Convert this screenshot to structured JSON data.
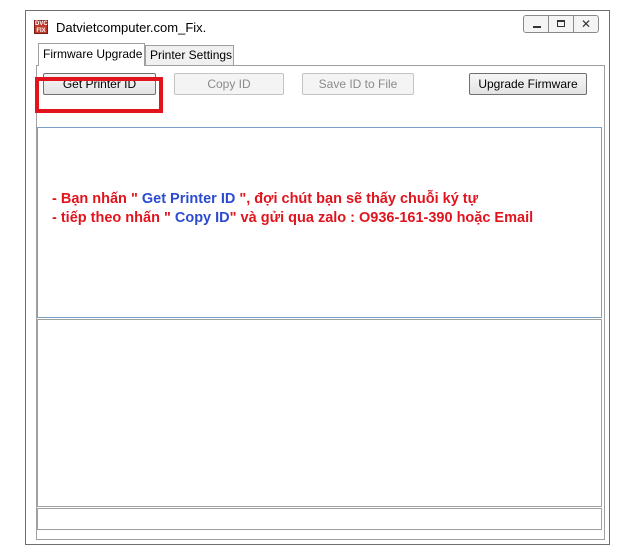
{
  "window": {
    "title": "Datvietcomputer.com_Fix.",
    "icon": "app-logo-icon",
    "controls": {
      "minimize": "minimize-icon",
      "maximize": "maximize-icon",
      "close": "close-icon"
    },
    "close_glyph": "✕"
  },
  "tabs": [
    {
      "label": "Firmware Upgrade",
      "active": true
    },
    {
      "label": "Printer Settings",
      "active": false
    }
  ],
  "toolbar": {
    "get_printer_id": "Get Printer ID",
    "copy_id": "Copy ID",
    "save_id_to_file": "Save ID to File",
    "upgrade_firmware": "Upgrade Firmware"
  },
  "message": {
    "line1_a": "- Bạn nhấn \" ",
    "line1_b": "Get Printer ID",
    "line1_c": " \", đợi chút bạn sẽ thấy chuỗi ký tự",
    "line2_a": "- tiếp theo nhấn \" ",
    "line2_b": "Copy ID",
    "line2_c": "\" và gửi qua zalo : O936-161-390 hoặc Email"
  },
  "colors": {
    "highlight": "#e1141e",
    "message_red": "#e1141e",
    "message_blue": "#2b4bd0"
  }
}
